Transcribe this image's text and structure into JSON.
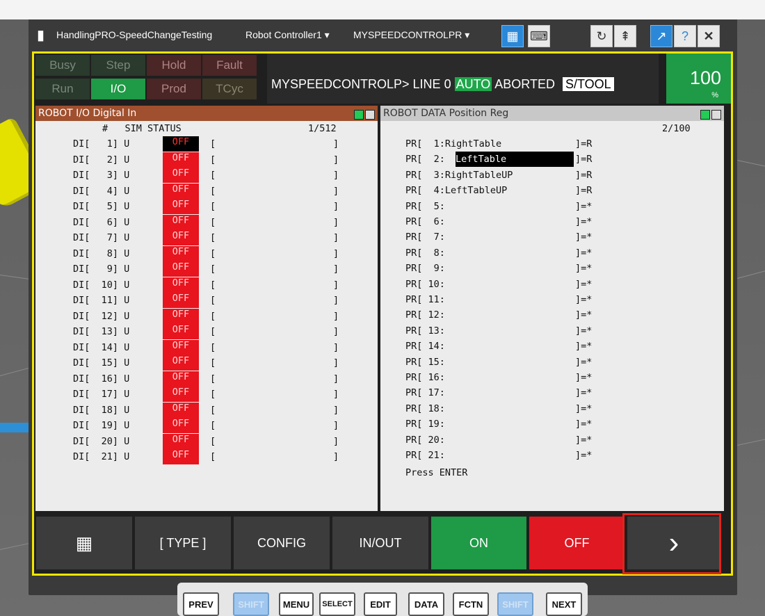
{
  "window": {
    "title": "HandlingPRO-SpeedChangeTesting",
    "controller": "Robot Controller1",
    "program": "MYSPEEDCONTROLPR"
  },
  "indicators": {
    "busy": "Busy",
    "step": "Step",
    "hold": "Hold",
    "fault": "Fault",
    "run": "Run",
    "io": "I/O",
    "prod": "Prod",
    "tcyc": "TCyc"
  },
  "status": {
    "program_line": "MYSPEEDCONTROLP> LINE 0",
    "mode": "AUTO",
    "state": "ABORTED",
    "frame": "S/TOOL",
    "override": "100",
    "override_unit": "%"
  },
  "left_panel": {
    "title": "ROBOT I/O Digital In",
    "columns": "#   SIM STATUS",
    "page": "1/512",
    "rows": [
      {
        "label": "DI[   1] U",
        "status": "OFF"
      },
      {
        "label": "DI[   2] U",
        "status": "OFF"
      },
      {
        "label": "DI[   3] U",
        "status": "OFF"
      },
      {
        "label": "DI[   4] U",
        "status": "OFF"
      },
      {
        "label": "DI[   5] U",
        "status": "OFF"
      },
      {
        "label": "DI[   6] U",
        "status": "OFF"
      },
      {
        "label": "DI[   7] U",
        "status": "OFF"
      },
      {
        "label": "DI[   8] U",
        "status": "OFF"
      },
      {
        "label": "DI[   9] U",
        "status": "OFF"
      },
      {
        "label": "DI[  10] U",
        "status": "OFF"
      },
      {
        "label": "DI[  11] U",
        "status": "OFF"
      },
      {
        "label": "DI[  12] U",
        "status": "OFF"
      },
      {
        "label": "DI[  13] U",
        "status": "OFF"
      },
      {
        "label": "DI[  14] U",
        "status": "OFF"
      },
      {
        "label": "DI[  15] U",
        "status": "OFF"
      },
      {
        "label": "DI[  16] U",
        "status": "OFF"
      },
      {
        "label": "DI[  17] U",
        "status": "OFF"
      },
      {
        "label": "DI[  18] U",
        "status": "OFF"
      },
      {
        "label": "DI[  19] U",
        "status": "OFF"
      },
      {
        "label": "DI[  20] U",
        "status": "OFF"
      },
      {
        "label": "DI[  21] U",
        "status": "OFF"
      }
    ],
    "bracket_open": "[",
    "bracket_close": "]"
  },
  "right_panel": {
    "title": "ROBOT  DATA Position Reg",
    "page": "2/100",
    "rows": [
      {
        "label": "PR[  1:RightTable",
        "value": "]=R"
      },
      {
        "label": "PR[  2:",
        "name": "LeftTable",
        "value": "]=R"
      },
      {
        "label": "PR[  3:RightTableUP",
        "value": "]=R"
      },
      {
        "label": "PR[  4:LeftTableUP",
        "value": "]=R"
      },
      {
        "label": "PR[  5:",
        "value": "]=*"
      },
      {
        "label": "PR[  6:",
        "value": "]=*"
      },
      {
        "label": "PR[  7:",
        "value": "]=*"
      },
      {
        "label": "PR[  8:",
        "value": "]=*"
      },
      {
        "label": "PR[  9:",
        "value": "]=*"
      },
      {
        "label": "PR[ 10:",
        "value": "]=*"
      },
      {
        "label": "PR[ 11:",
        "value": "]=*"
      },
      {
        "label": "PR[ 12:",
        "value": "]=*"
      },
      {
        "label": "PR[ 13:",
        "value": "]=*"
      },
      {
        "label": "PR[ 14:",
        "value": "]=*"
      },
      {
        "label": "PR[ 15:",
        "value": "]=*"
      },
      {
        "label": "PR[ 16:",
        "value": "]=*"
      },
      {
        "label": "PR[ 17:",
        "value": "]=*"
      },
      {
        "label": "PR[ 18:",
        "value": "]=*"
      },
      {
        "label": "PR[ 19:",
        "value": "]=*"
      },
      {
        "label": "PR[ 20:",
        "value": "]=*"
      },
      {
        "label": "PR[ 21:",
        "value": "]=*"
      }
    ],
    "prompt": "Press ENTER"
  },
  "softkeys": {
    "type": "[ TYPE ]",
    "config": "CONFIG",
    "inout": "IN/OUT",
    "on": "ON",
    "off": "OFF",
    "next_glyph": "›"
  },
  "keys": {
    "prev": "PREV",
    "shift": "SHIFT",
    "menu": "MENU",
    "select": "SELECT",
    "edit": "EDIT",
    "data": "DATA",
    "fctn": "FCTN",
    "next": "NEXT"
  },
  "colors": {
    "accent_yellow": "#f1e600",
    "status_green": "#1f9a46",
    "off_red": "#e01822"
  }
}
